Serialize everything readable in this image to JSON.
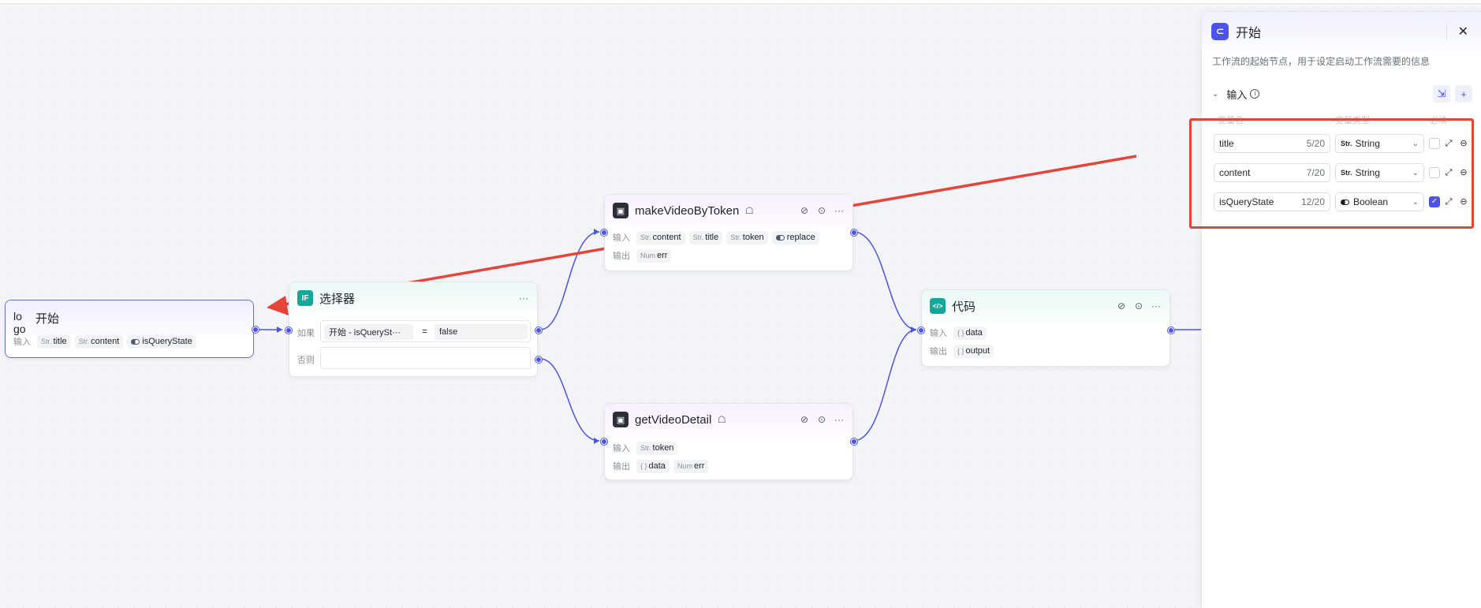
{
  "colors": {
    "accent": "#4d53e8",
    "annotation": "#e5443a",
    "teal": "#12a89a"
  },
  "start_node": {
    "broken_image_alt": "lo go",
    "title": "开始",
    "input_label": "输入",
    "inputs": [
      {
        "type": "Str.",
        "name": "title"
      },
      {
        "type": "Str.",
        "name": "content"
      },
      {
        "type": "toggle-icon",
        "name": "isQueryState"
      }
    ]
  },
  "selector_node": {
    "icon_text": "IF",
    "title": "选择器",
    "if_label": "如果",
    "else_label": "否则",
    "condition": {
      "left": "开始 - isQuerySt···",
      "operator": "=",
      "right": "false"
    }
  },
  "make_video_node": {
    "title": "makeVideoByToken",
    "input_label": "输入",
    "output_label": "输出",
    "inputs": [
      {
        "type": "Str.",
        "name": "content"
      },
      {
        "type": "Str.",
        "name": "title"
      },
      {
        "type": "Str.",
        "name": "token"
      },
      {
        "type": "toggle-icon",
        "name": "replace"
      }
    ],
    "outputs": [
      {
        "type": "Num",
        "name": "err"
      }
    ]
  },
  "get_video_node": {
    "title": "getVideoDetail",
    "input_label": "输入",
    "output_label": "输出",
    "inputs": [
      {
        "type": "Str.",
        "name": "token"
      }
    ],
    "outputs": [
      {
        "type": "{ }",
        "name": "data"
      },
      {
        "type": "Num",
        "name": "err"
      }
    ]
  },
  "code_node": {
    "icon_text": "</>",
    "title": "代码",
    "input_label": "输入",
    "output_label": "输出",
    "inputs": [
      {
        "type": "{ }",
        "name": "data"
      }
    ],
    "outputs": [
      {
        "type": "{ }",
        "name": "output"
      }
    ]
  },
  "panel": {
    "title": "开始",
    "description": "工作流的起始节点，用于设定启动工作流需要的信息",
    "section_title": "输入",
    "col_name": "变量名",
    "col_type": "变量类型",
    "col_required": "必填",
    "variables": [
      {
        "name": "title",
        "count": "5/20",
        "type_tag": "Str.",
        "type": "String",
        "required": false
      },
      {
        "name": "content",
        "count": "7/20",
        "type_tag": "Str.",
        "type": "String",
        "required": false
      },
      {
        "name": "isQueryState",
        "count": "12/20",
        "type_tag": "toggle-icon",
        "type": "Boolean",
        "required": true
      }
    ]
  }
}
